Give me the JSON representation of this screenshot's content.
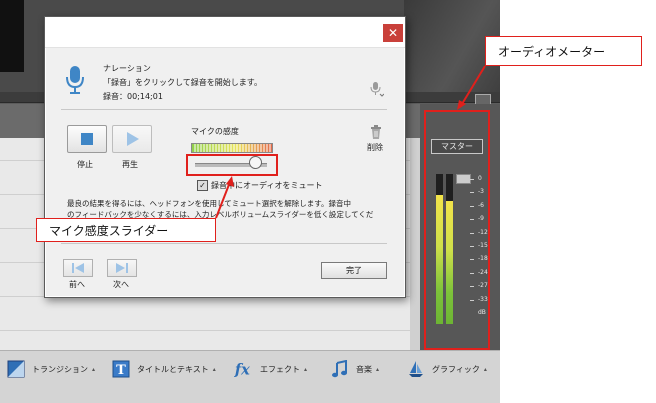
{
  "narration": {
    "title": "ナレーション",
    "instruction": "「録音」をクリックして録音を開始します。",
    "record_time": "録音：00;14;01"
  },
  "controls": {
    "stop_label": "停止",
    "play_label": "再生",
    "delete_label": "削除",
    "mic_sensitivity_label": "マイクの感度",
    "mute_checkbox_label": "録音中にオーディオをミュート",
    "mute_checked": true,
    "sensitivity_level": 0.82
  },
  "help_text": {
    "line1": "最良の結果を得るには、ヘッドフォンを使用してミュート選択を解除します。録音中",
    "line2": "のフィードバックを少なくするには、入力レベルボリュームスライダーを低く設定してくだ"
  },
  "nav": {
    "back_label": "前へ",
    "next_label": "次へ",
    "done_label": "完了"
  },
  "meter": {
    "master_label": "マスター",
    "scale": [
      "0",
      "-3",
      "-6",
      "-9",
      "-12",
      "-15",
      "-18",
      "-24",
      "-27",
      "-33",
      "dB"
    ],
    "left_level": 0.86,
    "right_level": 0.82
  },
  "bottom_toolbar": {
    "items": [
      {
        "label": "トランジション",
        "icon": "transition-icon"
      },
      {
        "label": "タイトルとテキスト",
        "icon": "title-text-icon"
      },
      {
        "label": "エフェクト",
        "icon": "effects-fx-icon"
      },
      {
        "label": "音楽",
        "icon": "music-note-icon"
      },
      {
        "label": "グラフィック",
        "icon": "graphics-sailboat-icon"
      }
    ]
  },
  "annotations": {
    "audio_meter_callout": "オーディオメーター",
    "mic_slider_callout": "マイク感度スライダー"
  },
  "colors": {
    "annotation_red": "#e0201c",
    "meter_green": "#7cc23a",
    "meter_yellow": "#f2e34a",
    "close_red": "#c9403a",
    "mic_blue": "#3f86c6"
  }
}
